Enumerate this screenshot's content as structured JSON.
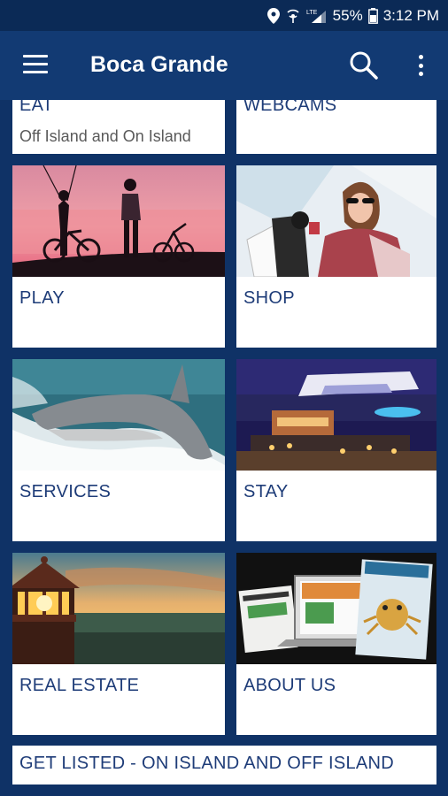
{
  "status_bar": {
    "battery": "55%",
    "time": "3:12 PM"
  },
  "app_bar": {
    "title": "Boca Grande"
  },
  "tiles": {
    "eat": {
      "label": "EAT",
      "subtitle": "Off Island and On Island"
    },
    "webcams": {
      "label": "WEBCAMS"
    },
    "play": {
      "label": "PLAY"
    },
    "shop": {
      "label": "SHOP"
    },
    "services": {
      "label": "SERVICES"
    },
    "stay": {
      "label": "STAY"
    },
    "real_estate": {
      "label": "REAL ESTATE"
    },
    "about_us": {
      "label": "ABOUT US"
    },
    "get_listed": {
      "label": "GET LISTED - ON ISLAND AND OFF ISLAND"
    }
  },
  "icons": [
    "location-icon",
    "hotspot-icon",
    "lte-signal-icon",
    "battery-icon",
    "menu-icon",
    "search-icon",
    "more-vert-icon"
  ],
  "colors": {
    "background": "#0f3266",
    "app_bar": "#123a73",
    "label_text": "#1e3c78"
  }
}
